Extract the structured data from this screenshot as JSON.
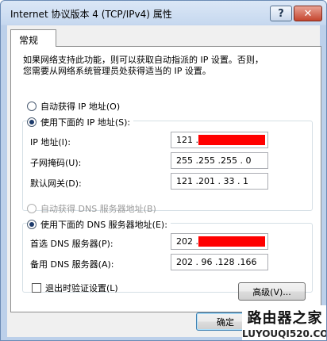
{
  "window": {
    "title": "Internet 协议版本 4 (TCP/IPv4) 属性",
    "help_label": "?",
    "close_label": "✕"
  },
  "tabs": [
    {
      "label": "常规"
    }
  ],
  "description": "如果网络支持此功能，则可以获取自动指派的 IP 设置。否则，\n您需要从网络系统管理员处获得适当的 IP 设置。",
  "ip_section": {
    "auto_label": "自动获得 IP 地址(O)",
    "manual_label": "使用下面的 IP 地址(S):",
    "selected": "manual",
    "fields": [
      {
        "label": "IP 地址(I):",
        "value": "121 .",
        "redacted": true
      },
      {
        "label": "子网掩码(U):",
        "value": "255 .255 .255 . 0",
        "redacted": false
      },
      {
        "label": "默认网关(D):",
        "value": "121 .201 . 33 . 1",
        "redacted": false
      }
    ]
  },
  "dns_section": {
    "auto_label": "自动获得 DNS 服务器地址(B)",
    "auto_disabled": true,
    "manual_label": "使用下面的 DNS 服务器地址(E):",
    "selected": "manual",
    "fields": [
      {
        "label": "首选 DNS 服务器(P):",
        "value": "202 .",
        "redacted": true
      },
      {
        "label": "备用 DNS 服务器(A):",
        "value": "202 . 96 .128 .166",
        "redacted": false
      }
    ]
  },
  "validate_on_exit": {
    "label": "退出时验证设置(L)",
    "checked": false
  },
  "advanced_button": "高级(V)...",
  "ok_button": "确定",
  "watermark": {
    "line1": "路由器之家",
    "line2": "LUYOUQI520.COM"
  },
  "colors": {
    "redaction": "#ff0000",
    "title_bar": "#c6d8ef"
  }
}
